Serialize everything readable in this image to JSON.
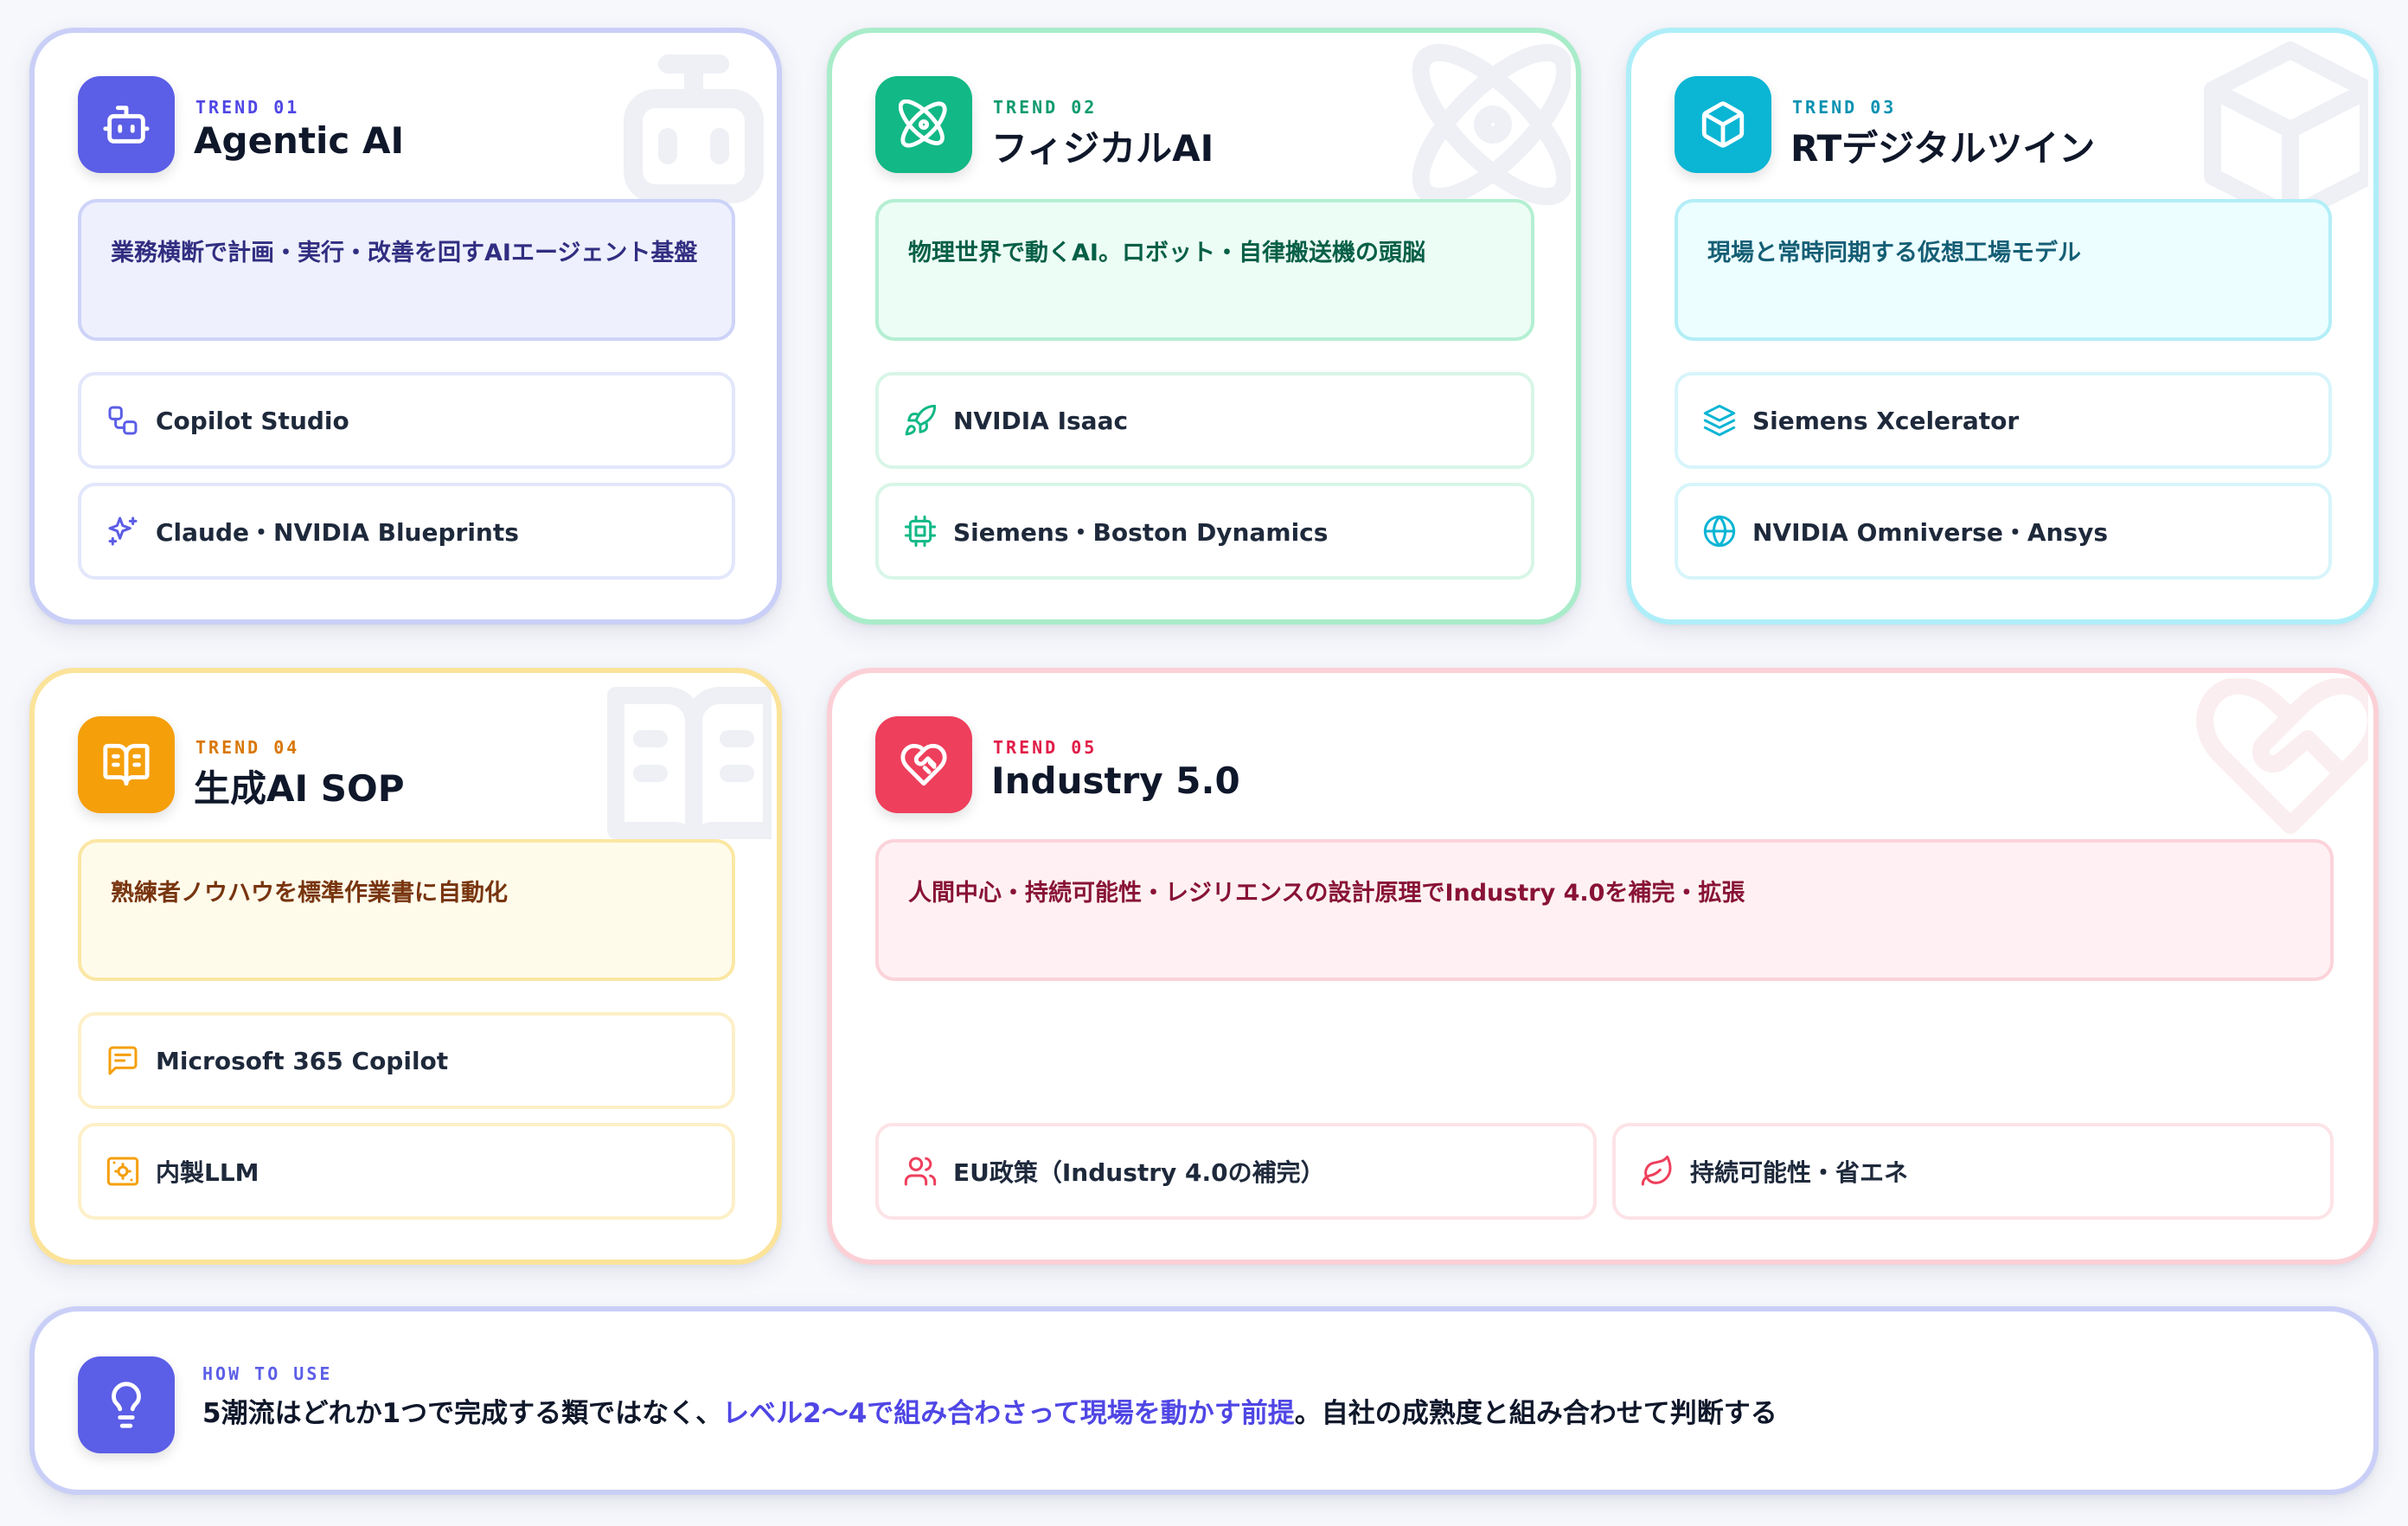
{
  "colors": {
    "blue": "#5b5ee6",
    "green": "#12b886",
    "cyan": "#0bb5d4",
    "yellow": "#f59f0b",
    "red": "#ee3f5c"
  },
  "trends": [
    {
      "label": "TREND 01",
      "title": "Agentic AI",
      "icon": "robot-icon",
      "description": "業務横断で計画・実行・改善を回すAIエージェント基盤",
      "tools": [
        {
          "icon": "workflow-icon",
          "label": "Copilot Studio"
        },
        {
          "icon": "sparkles-icon",
          "label": "Claude・NVIDIA Blueprints"
        }
      ]
    },
    {
      "label": "TREND 02",
      "title": "フィジカルAI",
      "icon": "atom-icon",
      "description": "物理世界で動くAI。ロボット・自律搬送機の頭脳",
      "tools": [
        {
          "icon": "rocket-icon",
          "label": "NVIDIA Isaac"
        },
        {
          "icon": "chip-icon",
          "label": "Siemens・Boston Dynamics"
        }
      ]
    },
    {
      "label": "TREND 03",
      "title": "RTデジタルツイン",
      "icon": "cube-icon",
      "description": "現場と常時同期する仮想工場モデル",
      "tools": [
        {
          "icon": "layers-icon",
          "label": "Siemens Xcelerator"
        },
        {
          "icon": "globe-icon",
          "label": "NVIDIA Omniverse・Ansys"
        }
      ]
    },
    {
      "label": "TREND 04",
      "title": "生成AI SOP",
      "icon": "book-open-icon",
      "description": "熟練者ノウハウを標準作業書に自動化",
      "tools": [
        {
          "icon": "message-icon",
          "label": "Microsoft 365 Copilot"
        },
        {
          "icon": "server-cog-icon",
          "label": "内製LLM"
        }
      ]
    },
    {
      "label": "TREND 05",
      "title": "Industry 5.0",
      "icon": "heart-handshake-icon",
      "description": "人間中心・持続可能性・レジリエンスの設計原理でIndustry 4.0を補完・拡張",
      "tools": [
        {
          "icon": "users-icon",
          "label": "EU政策（Industry 4.0の補完）"
        },
        {
          "icon": "leaf-icon",
          "label": "持続可能性・省エネ"
        }
      ]
    }
  ],
  "howto": {
    "label": "HOW TO USE",
    "icon": "lightbulb-icon",
    "text_before": "5潮流はどれか1つで完成する類ではなく、",
    "text_highlight": "レベル2〜4で組み合わさって現場を動かす前提",
    "text_after": "。自社の成熟度と組み合わせて判断する"
  }
}
